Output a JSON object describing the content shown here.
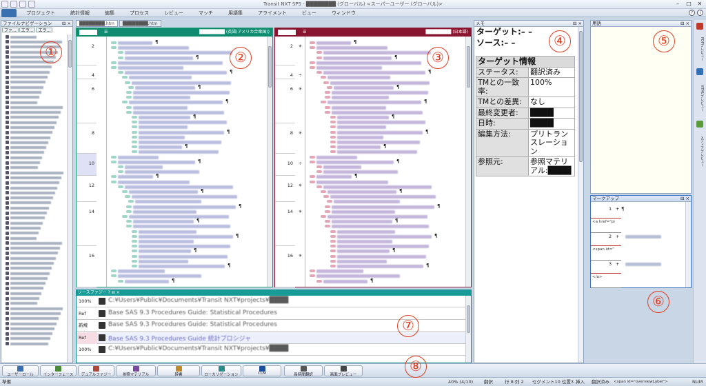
{
  "window": {
    "title": "Transit NXT SP5 - ████████ (グローバル) <スーパーユーザー (グローバル)>",
    "controls": [
      "–",
      "□",
      "✕"
    ]
  },
  "menu": {
    "app_button": "",
    "items": [
      "プロジェクト",
      "統計情報",
      "編集",
      "プロセス",
      "レビュー",
      "マッチ",
      "用語集",
      "アライメント",
      "ビュー",
      "ウィンドウ"
    ]
  },
  "file_nav": {
    "title": "ファイルナビゲーション",
    "tabs": [
      "ファ...",
      "エラ...",
      "エラ..."
    ],
    "row_count": 62
  },
  "doc_tabs": [
    "████████.htm",
    "████████.htm"
  ],
  "source_pane": {
    "header_file": "████████",
    "language": "(英語(アメリカ合衆国))",
    "segments": [
      {
        "num": "2",
        "mark": ""
      },
      {
        "num": "4",
        "mark": ""
      },
      {
        "num": "6",
        "mark": ""
      },
      {
        "num": "8",
        "mark": ""
      },
      {
        "num": "10",
        "mark": ""
      },
      {
        "num": "12",
        "mark": ""
      },
      {
        "num": "14",
        "mark": ""
      },
      {
        "num": "16",
        "mark": ""
      }
    ]
  },
  "target_pane": {
    "header_file": "████████",
    "language": "(日本語)",
    "segments": [
      {
        "num": "2",
        "mark": "✳"
      },
      {
        "num": "4",
        "mark": "÷"
      },
      {
        "num": "6",
        "mark": "✳"
      },
      {
        "num": "8",
        "mark": "✳"
      },
      {
        "num": "10",
        "mark": "÷"
      },
      {
        "num": "12",
        "mark": "✳"
      },
      {
        "num": "14",
        "mark": "✳"
      },
      {
        "num": "16",
        "mark": "✳"
      }
    ]
  },
  "memo": {
    "title": "メモ",
    "target_line": "ターゲット:– –",
    "source_line": "ソース:– –",
    "table_header": "ターゲット情報",
    "rows": [
      {
        "key": "ステータス:",
        "value": "翻訳済み"
      },
      {
        "key": "TMとの一致率:",
        "value": "100%"
      },
      {
        "key": "TMとの差異:",
        "value": "なし"
      },
      {
        "key": "最終変更者:",
        "value": "████"
      },
      {
        "key": "日時:",
        "value": "████"
      },
      {
        "key": "編集方法:",
        "value": "プリトランスレーション"
      },
      {
        "key": "参照元:",
        "value": "参照マテリアル:████"
      }
    ]
  },
  "dictionary": {
    "title": "用語"
  },
  "markup": {
    "title": "マークアップ",
    "rows": [
      {
        "num": "1",
        "mark": "+",
        "tag": "¶"
      },
      {
        "num": "",
        "mark": "",
        "tag": "<a href=\"pi"
      },
      {
        "num": "2",
        "mark": "+",
        "tag": ""
      },
      {
        "num": "",
        "mark": "",
        "tag": "<span id=\""
      },
      {
        "num": "3",
        "mark": "+",
        "tag": ""
      },
      {
        "num": "",
        "mark": "",
        "tag": "</a>"
      }
    ]
  },
  "right_sidebar": [
    "PDFプレビュー",
    "HTMLプレビュー",
    "メディアプレビュー"
  ],
  "fuzzy": {
    "title": "ソースファジー",
    "rows": [
      {
        "label": "100%",
        "text": "C:¥Users¥Public¥Documents¥Transit NXT¥projects¥████"
      },
      {
        "label": "Ref",
        "text": "Base SAS 9.3 Procedures Guide: Statistical Procedures"
      },
      {
        "label": "新規",
        "text": "Base SAS 9.3 Procedures Guide: Statistical Procedures"
      },
      {
        "label": "Ref",
        "text": "Base SAS 9.3 Procedures Guide 統計プロシジャ"
      },
      {
        "label": "100%",
        "text": "C:¥Users¥Public¥Documents¥Transit NXT¥projects¥████"
      }
    ]
  },
  "bottom_tools": [
    "ユーザーロール",
    "インターフェース",
    "デュアルファジー",
    "参照マテリアル",
    "辞書",
    "ローカリゼーション",
    "CLM",
    "長時間翻訳",
    "画面プレビュー"
  ],
  "status": {
    "left": "準備",
    "zoom": "40% (4/10)",
    "state": "翻訳",
    "pos": "行 8:列 2",
    "segment": "セグメント10 位置3",
    "insert": "挿入",
    "translated": "翻訳済み",
    "tag": "<span id=\"overviewLabel\">",
    "mode": "NUM"
  },
  "annotations": [
    "①",
    "②",
    "③",
    "④",
    "⑤",
    "⑥",
    "⑦",
    "⑧"
  ],
  "colors": {
    "source_header": "#0f8b70",
    "target_header": "#8a1530",
    "annotation": "#e23b1f"
  }
}
